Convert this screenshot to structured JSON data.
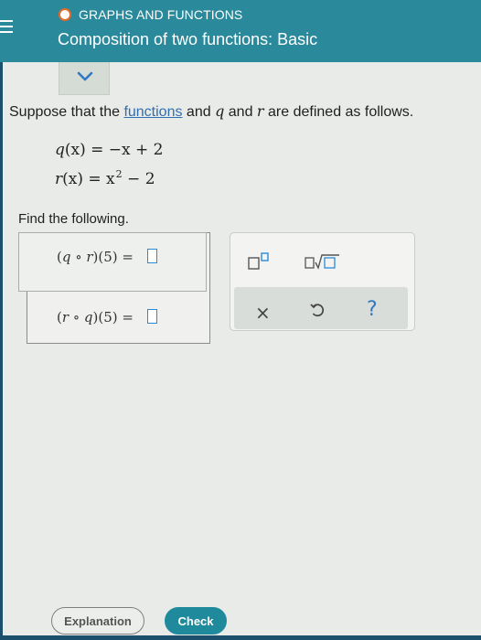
{
  "header": {
    "topic": "GRAPHS AND FUNCTIONS",
    "title": "Composition of two functions: Basic"
  },
  "problem": {
    "intro_before": "Suppose that the ",
    "intro_link": "functions",
    "var_q": "q",
    "intro_and": " and ",
    "var_r": "r",
    "intro_after": " are defined as follows.",
    "eq1": {
      "lhs": "q",
      "arg": "(x)",
      "rhs": " = −x + 2"
    },
    "eq2": {
      "lhs": "r",
      "arg": "(x)",
      "rhs_a": " = x",
      "exp": "2",
      "rhs_b": " − 2"
    },
    "find_label": "Find the following."
  },
  "answers": [
    {
      "open": "(",
      "f": "q",
      "op": " ∘ ",
      "g": "r",
      "close": ")(5) = "
    },
    {
      "open": "(",
      "f": "r",
      "op": " ∘ ",
      "g": "q",
      "close": ")(5) = "
    }
  ],
  "palette": {
    "clear_symbol": "×",
    "help_symbol": "?"
  },
  "buttons": {
    "explanation": "Explanation",
    "check": "Check"
  },
  "colors": {
    "header": "#2a8a9c",
    "accent_orange": "#e46a2c",
    "input_border": "#2a8ad6",
    "link": "#2f6fb0"
  },
  "icons": [
    "menu-icon",
    "chevron-down-icon",
    "superscript-icon",
    "square-root-icon",
    "undo-icon",
    "help-icon",
    "clear-icon"
  ]
}
